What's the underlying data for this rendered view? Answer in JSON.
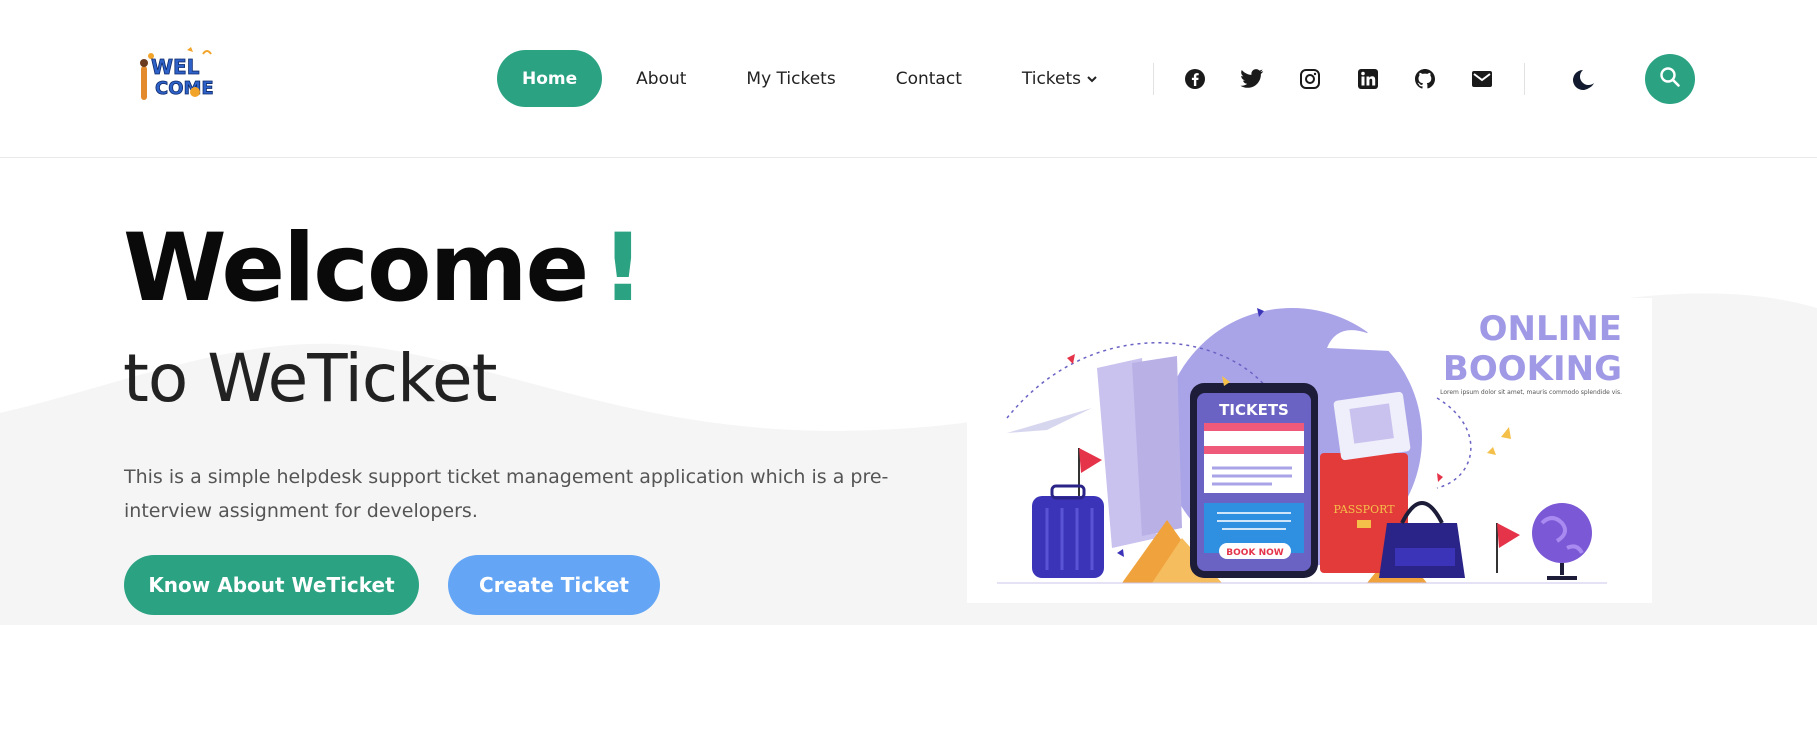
{
  "colors": {
    "accent": "#2ba383",
    "secondary_button": "#64a6f5",
    "hero_background": "#f5f5f5"
  },
  "header": {
    "logo_text_top": "WEL",
    "logo_text_bottom": "COME",
    "nav": [
      {
        "label": "Home",
        "active": true
      },
      {
        "label": "About",
        "active": false
      },
      {
        "label": "My Tickets",
        "active": false
      },
      {
        "label": "Contact",
        "active": false
      },
      {
        "label": "Tickets",
        "active": false,
        "has_dropdown": true
      }
    ],
    "social_icons": [
      "facebook-icon",
      "twitter-icon",
      "instagram-icon",
      "linkedin-icon",
      "github-icon",
      "mail-icon"
    ],
    "theme_icon": "moon-icon",
    "search_icon": "search-icon"
  },
  "hero": {
    "title": "Welcome",
    "title_bang": "!",
    "subtitle": "to WeTicket",
    "description": "This is a simple helpdesk support ticket management application which is a pre-interview assignment for developers.",
    "primary_button": "Know About WeTicket",
    "secondary_button": "Create Ticket"
  },
  "illustration": {
    "heading_line1": "ONLINE",
    "heading_line2": "BOOKING",
    "caption": "Lorem ipsum dolor sit amet, mauris commodo splendide vis.",
    "phone_title": "TICKETS",
    "phone_button": "BOOK NOW",
    "passport_label": "PASSPORT"
  }
}
